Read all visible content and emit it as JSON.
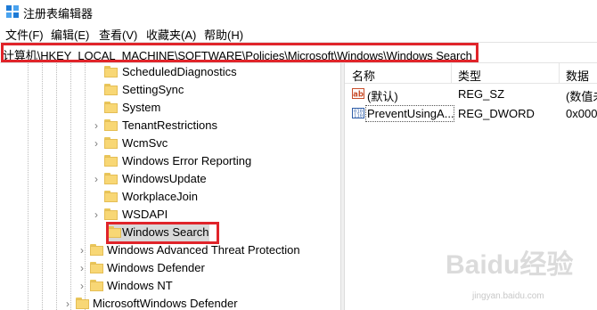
{
  "window": {
    "title": "注册表编辑器"
  },
  "menu": [
    "文件(F)",
    "编辑(E)",
    "查看(V)",
    "收藏夹(A)",
    "帮助(H)"
  ],
  "address": "计算机\\HKEY_LOCAL_MACHINE\\SOFTWARE\\Policies\\Microsoft\\Windows\\Windows Search",
  "tree": [
    {
      "label": "ScheduledDiagnostics",
      "expander": false
    },
    {
      "label": "SettingSync",
      "expander": false
    },
    {
      "label": "System",
      "expander": false
    },
    {
      "label": "TenantRestrictions",
      "expander": true
    },
    {
      "label": "WcmSvc",
      "expander": true
    },
    {
      "label": "Windows Error Reporting",
      "expander": false
    },
    {
      "label": "WindowsUpdate",
      "expander": true
    },
    {
      "label": "WorkplaceJoin",
      "expander": false
    },
    {
      "label": "WSDAPI",
      "expander": true
    },
    {
      "label": "Windows Search",
      "expander": false,
      "selected": true
    },
    {
      "label": "Windows Advanced Threat Protection",
      "expander": true
    },
    {
      "label": "Windows Defender",
      "expander": true
    },
    {
      "label": "Windows NT",
      "expander": true
    },
    {
      "label": "MicrosoftWindows Defender",
      "expander": true
    }
  ],
  "list": {
    "columns": [
      "名称",
      "类型",
      "数据"
    ],
    "rows": [
      {
        "name": "(默认)",
        "type": "REG_SZ",
        "data": "(数值未",
        "icon": "string-value-icon"
      },
      {
        "name": "PreventUsingA...",
        "type": "REG_DWORD",
        "data": "0x000",
        "icon": "dword-value-icon"
      }
    ]
  },
  "watermark": {
    "main": "Baidu经验",
    "sub": "jingyan.baidu.com"
  }
}
